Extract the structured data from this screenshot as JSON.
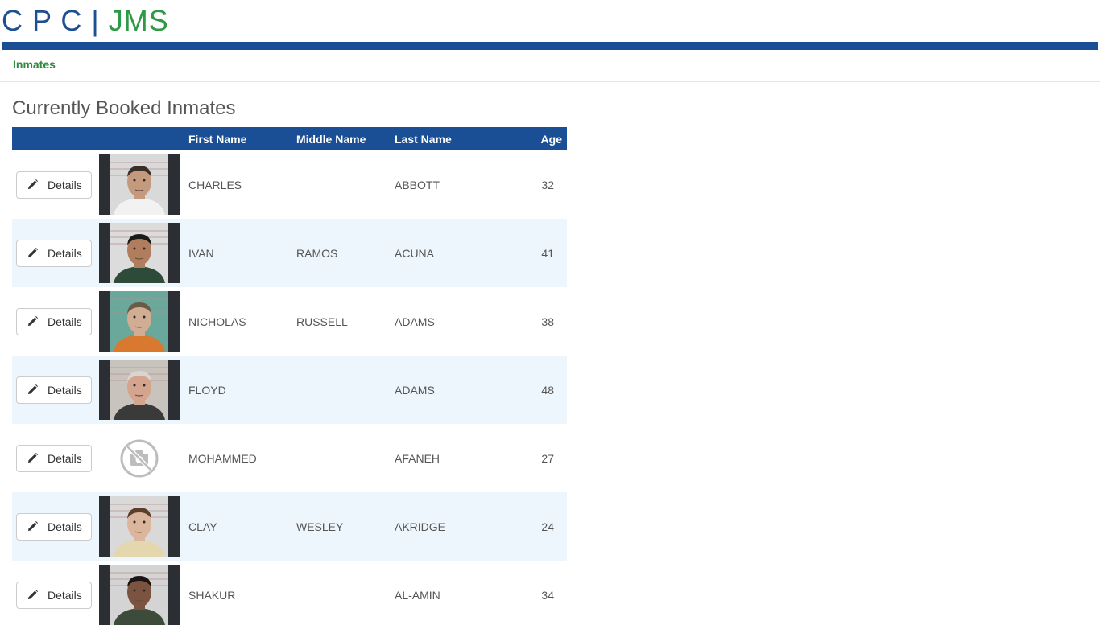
{
  "header": {
    "logo_part1": "C P C",
    "logo_sep": "|",
    "logo_part2": "JMS"
  },
  "nav": {
    "inmates_link": "Inmates"
  },
  "page": {
    "title": "Currently Booked Inmates"
  },
  "table": {
    "columns": {
      "first": "First Name",
      "middle": "Middle Name",
      "last": "Last Name",
      "age": "Age"
    },
    "details_label": "Details",
    "rows": [
      {
        "first": "CHARLES",
        "middle": "",
        "last": "ABBOTT",
        "age": "32",
        "photo": "mugshot",
        "bg": "#d9d9d9",
        "shirt": "#f2f2f2",
        "skin": "#c49a7f",
        "hair": "#3a2e28"
      },
      {
        "first": "IVAN",
        "middle": "RAMOS",
        "last": "ACUNA",
        "age": "41",
        "photo": "mugshot",
        "bg": "#dcdcdc",
        "shirt": "#2e4a38",
        "skin": "#b07e5e",
        "hair": "#1c1a18"
      },
      {
        "first": "NICHOLAS",
        "middle": "RUSSELL",
        "last": "ADAMS",
        "age": "38",
        "photo": "mugshot",
        "bg": "#6aa89b",
        "shirt": "#d9792f",
        "skin": "#d1ad94",
        "hair": "#6b5a47"
      },
      {
        "first": "FLOYD",
        "middle": "",
        "last": "ADAMS",
        "age": "48",
        "photo": "mugshot",
        "bg": "#c9c3bd",
        "shirt": "#3a3a3a",
        "skin": "#d4a48e",
        "hair": "#d9d4cf"
      },
      {
        "first": "MOHAMMED",
        "middle": "",
        "last": "AFANEH",
        "age": "27",
        "photo": "none"
      },
      {
        "first": "CLAY",
        "middle": "WESLEY",
        "last": "AKRIDGE",
        "age": "24",
        "photo": "mugshot",
        "bg": "#d9d9d9",
        "shirt": "#e4d7ad",
        "skin": "#dbb69c",
        "hair": "#5b3f2a"
      },
      {
        "first": "SHAKUR",
        "middle": "",
        "last": "AL-AMIN",
        "age": "34",
        "photo": "mugshot",
        "bg": "#d4d4d4",
        "shirt": "#3d4b3a",
        "skin": "#7a5440",
        "hair": "#1a1412"
      }
    ]
  }
}
